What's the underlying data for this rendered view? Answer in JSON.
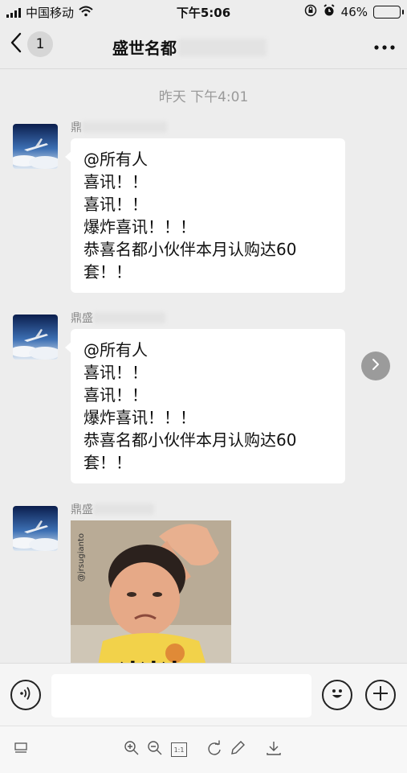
{
  "status_bar": {
    "carrier": "中国移动",
    "time": "下午5:06",
    "battery": "46%",
    "battery_level": 0.46,
    "icons": [
      "signal-icon",
      "wifi-icon",
      "rotation-lock-icon",
      "alarm-icon",
      "battery-icon"
    ]
  },
  "nav": {
    "back_icon": "chevron-left-icon",
    "unread_count": "1",
    "title": "盛世名都",
    "more_icon": "more-icon"
  },
  "chat": {
    "timestamp": "昨天 下午4:01",
    "messages": [
      {
        "sender": "鼎",
        "lines": [
          "@所有人",
          "喜讯！！",
          "喜讯！！",
          "爆炸喜讯！！！",
          "恭喜名都小伙伴本月认购达60",
          "套！！"
        ]
      },
      {
        "sender": "鼎盛",
        "lines": [
          "@所有人",
          "喜讯！！",
          "喜讯！！",
          "爆炸喜讯！！！",
          "恭喜名都小伙伴本月认购达60",
          "套！！"
        ],
        "forward_icon": "forward-icon"
      },
      {
        "sender": "鼎盛",
        "sticker_caption": "冲冲冲",
        "sticker_watermark": "@jrsugianto"
      }
    ]
  },
  "input_bar": {
    "voice_icon": "voice-icon",
    "input_value": "",
    "emoji_icon": "emoji-icon",
    "plus_icon": "plus-icon"
  },
  "viewer_toolbar": {
    "icons": [
      "layout-icon",
      "zoom-in-icon",
      "zoom-out-icon",
      "actual-size-icon",
      "rotate-icon",
      "edit-icon",
      "download-icon"
    ],
    "actual_size_label": "1:1"
  },
  "colors": {
    "background": "#ededed",
    "bubble": "#ffffff",
    "timestamp": "#9a9a9a",
    "forward_button": "#9b9b9b"
  }
}
